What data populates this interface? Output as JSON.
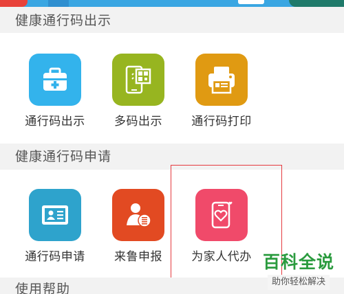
{
  "sections": [
    {
      "title": "健康通行码出示",
      "items": [
        {
          "label": "通行码出示",
          "icon": "medical-kit-icon",
          "color": "#33b3ec"
        },
        {
          "label": "多码出示",
          "icon": "phone-qr-icon",
          "color": "#97b520"
        },
        {
          "label": "通行码打印",
          "icon": "printer-icon",
          "color": "#e09a12"
        }
      ]
    },
    {
      "title": "健康通行码申请",
      "items": [
        {
          "label": "通行码申请",
          "icon": "id-card-icon",
          "color": "#2ea3cc"
        },
        {
          "label": "来鲁申报",
          "icon": "person-doc-icon",
          "color": "#e24a22"
        },
        {
          "label": "为家人代办",
          "icon": "phone-heart-icon",
          "color": "#f04a6a"
        }
      ]
    },
    {
      "title": "使用帮助"
    }
  ],
  "watermark": {
    "title": "百科全说",
    "subtitle": "助你轻松解决"
  }
}
